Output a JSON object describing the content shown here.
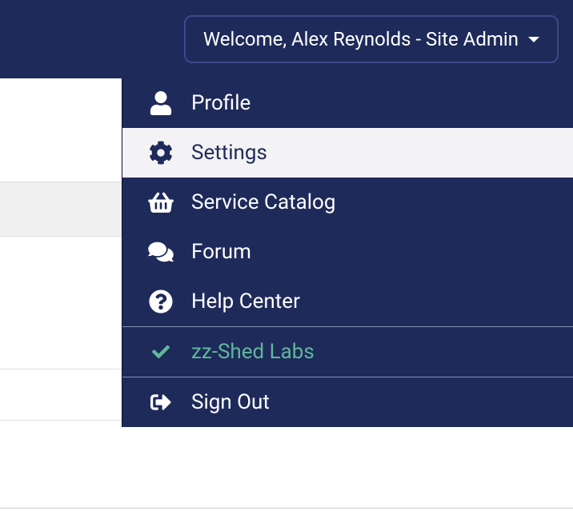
{
  "header": {
    "welcome_text": "Welcome, Alex Reynolds - Site Admin"
  },
  "menu": {
    "profile_label": "Profile",
    "settings_label": "Settings",
    "service_catalog_label": "Service Catalog",
    "forum_label": "Forum",
    "help_center_label": "Help Center",
    "tenant_label": "zz-Shed Labs",
    "sign_out_label": "Sign Out"
  },
  "colors": {
    "navy": "#1e2a5a",
    "teal": "#5fb89a",
    "hover_bg": "#f3f3f5"
  }
}
